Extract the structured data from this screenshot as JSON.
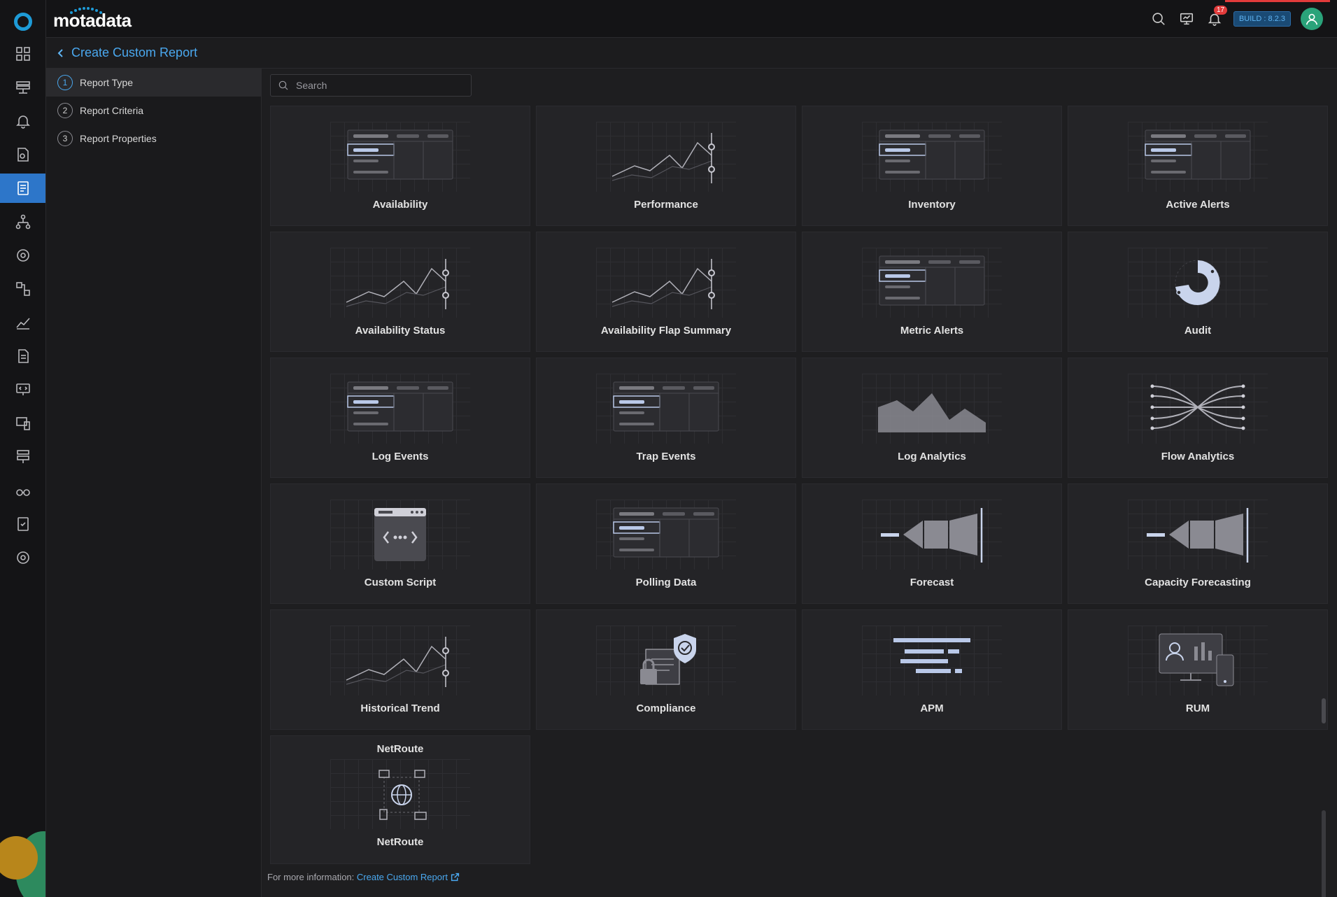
{
  "app": {
    "brand": "motadata",
    "build": "BUILD : 8.2.3",
    "notifications_count": "17"
  },
  "rail": {
    "items": [
      "dashboard-icon",
      "monitor-icon",
      "alert-bell-icon",
      "policy-icon",
      "reports-icon",
      "topology-icon",
      "discovery-icon",
      "flow-icon",
      "trend-icon",
      "log-icon",
      "apm-icon",
      "devices-icon",
      "network-icon",
      "explore-icon",
      "compliance-icon",
      "settings-icon"
    ],
    "active_index": 4
  },
  "page": {
    "title": "Create Custom Report"
  },
  "steps": [
    {
      "num": "1",
      "label": "Report Type"
    },
    {
      "num": "2",
      "label": "Report Criteria"
    },
    {
      "num": "3",
      "label": "Report Properties"
    }
  ],
  "search": {
    "placeholder": "Search",
    "value": ""
  },
  "report_types": [
    {
      "label": "Availability",
      "icon": "table"
    },
    {
      "label": "Performance",
      "icon": "line"
    },
    {
      "label": "Inventory",
      "icon": "table"
    },
    {
      "label": "Active Alerts",
      "icon": "table"
    },
    {
      "label": "Availability Status",
      "icon": "line"
    },
    {
      "label": "Availability Flap Summary",
      "icon": "line"
    },
    {
      "label": "Metric Alerts",
      "icon": "table"
    },
    {
      "label": "Audit",
      "icon": "donut"
    },
    {
      "label": "Log Events",
      "icon": "table"
    },
    {
      "label": "Trap Events",
      "icon": "table"
    },
    {
      "label": "Log Analytics",
      "icon": "area"
    },
    {
      "label": "Flow Analytics",
      "icon": "flow"
    },
    {
      "label": "Custom Script",
      "icon": "script"
    },
    {
      "label": "Polling Data",
      "icon": "table"
    },
    {
      "label": "Forecast",
      "icon": "forecast"
    },
    {
      "label": "Capacity Forecasting",
      "icon": "forecast"
    },
    {
      "label": "Historical Trend",
      "icon": "line"
    },
    {
      "label": "Compliance",
      "icon": "compliance"
    },
    {
      "label": "APM",
      "icon": "apm"
    },
    {
      "label": "RUM",
      "icon": "rum"
    }
  ],
  "netroute": {
    "top_label": "NetRoute",
    "label": "NetRoute",
    "icon": "netroute"
  },
  "footer": {
    "prefix": "For more information:",
    "link": "Create Custom Report"
  },
  "colors": {
    "accent": "#4aa8ef",
    "active_rail": "#2d76c9",
    "badge_red": "#e23b3b"
  }
}
